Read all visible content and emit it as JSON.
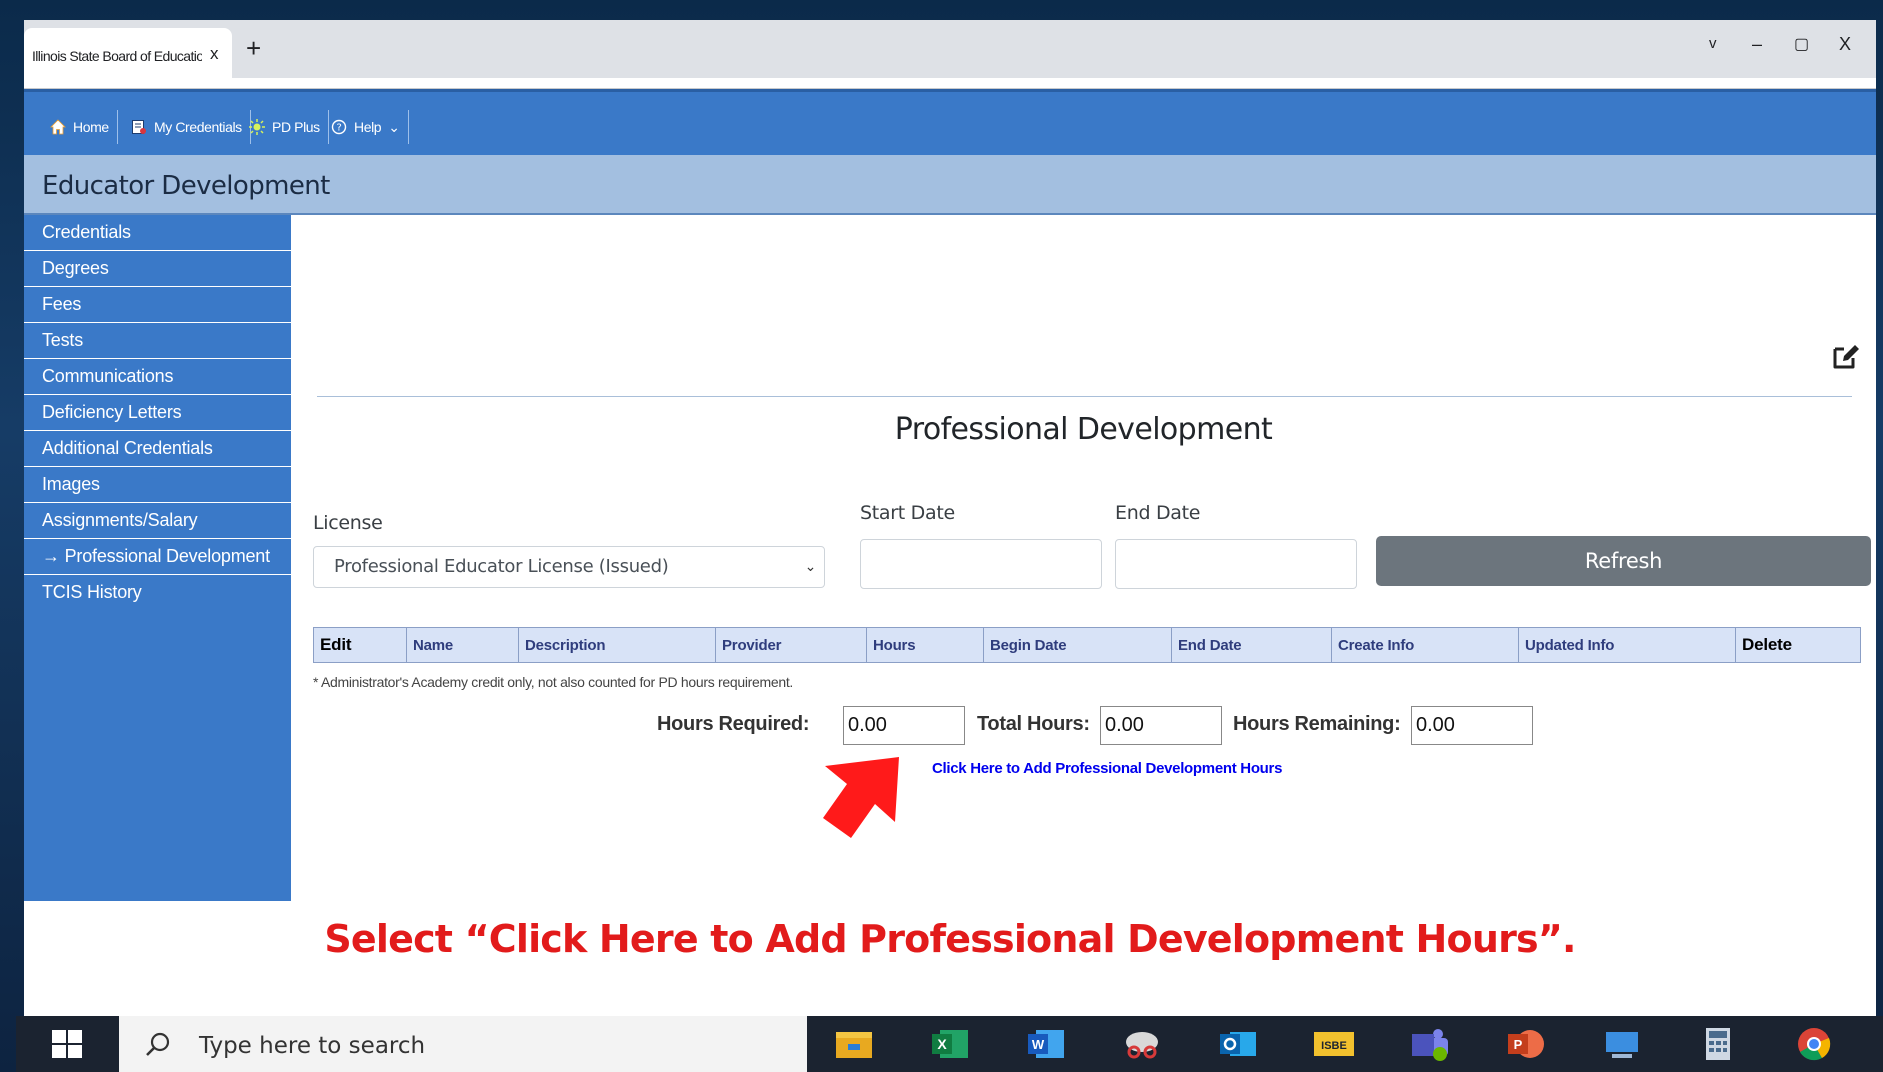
{
  "browser": {
    "tab_title": "Illinois State Board of Education",
    "tab_close": "x",
    "new_tab": "+",
    "controls": {
      "chevron": "v",
      "minimize": "–",
      "restore": "▢",
      "close": "X"
    }
  },
  "topnav": {
    "items": [
      {
        "label": "Home",
        "icon": "home-icon"
      },
      {
        "label": "My Credentials",
        "icon": "credentials-icon"
      },
      {
        "label": "PD Plus",
        "icon": "pd-plus-icon"
      },
      {
        "label": "Help",
        "icon": "help-icon"
      }
    ],
    "help_chevron": "⌄"
  },
  "header": {
    "title": "Educator Development"
  },
  "sidebar": {
    "items": [
      {
        "label": "Credentials"
      },
      {
        "label": "Degrees"
      },
      {
        "label": "Fees"
      },
      {
        "label": "Tests"
      },
      {
        "label": "Communications"
      },
      {
        "label": "Deficiency Letters"
      },
      {
        "label": "Additional Credentials"
      },
      {
        "label": "Images"
      },
      {
        "label": "Assignments/Salary"
      },
      {
        "label": "→ Professional Development",
        "active": true
      },
      {
        "label": "TCIS History"
      }
    ]
  },
  "main": {
    "title": "Professional Development",
    "filters": {
      "license_label": "License",
      "license_value": "Professional Educator License (Issued)",
      "start_date_label": "Start Date",
      "start_date_value": "",
      "end_date_label": "End Date",
      "end_date_value": "",
      "refresh_label": "Refresh"
    },
    "table": {
      "columns": [
        "Edit",
        "Name",
        "Description",
        "Provider",
        "Hours",
        "Begin Date",
        "End Date",
        "Create Info",
        "Updated Info",
        "Delete"
      ],
      "rows": []
    },
    "footnote": "* Administrator's Academy credit only, not also counted for PD hours requirement.",
    "hours": {
      "required_label": "Hours Required:",
      "required_value": "0.00",
      "total_label": "Total Hours:",
      "total_value": "0.00",
      "remaining_label": "Hours Remaining:",
      "remaining_value": "0.00"
    },
    "add_link": "Click Here to Add Professional Development Hours"
  },
  "instruction": "Select “Click Here to Add Professional Development Hours”.",
  "taskbar": {
    "search_placeholder": "Type here to search",
    "apps": [
      "file-explorer",
      "excel",
      "word",
      "snipping-tool",
      "outlook",
      "isbe",
      "teams",
      "powerpoint",
      "remote-desktop",
      "calculator",
      "chrome"
    ]
  },
  "colors": {
    "nav_blue": "#3a79c8",
    "header_blue": "#a3bfe0",
    "instruction_red": "#e21b1b",
    "refresh_gray": "#6c757d"
  }
}
